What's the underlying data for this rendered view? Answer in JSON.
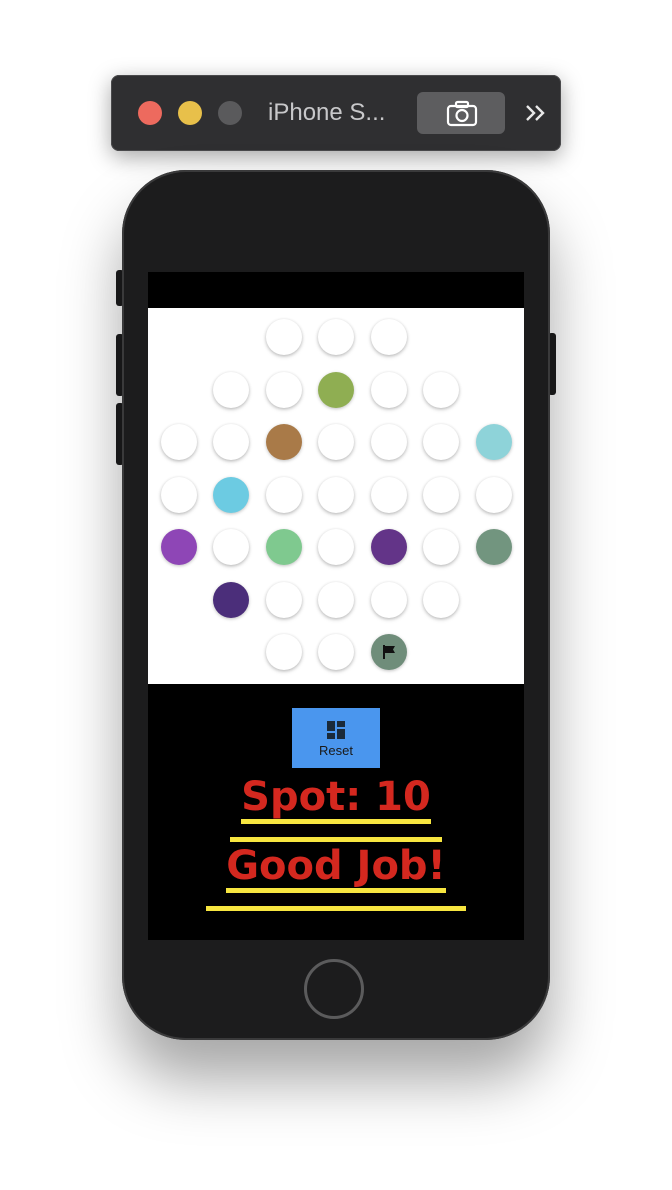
{
  "window": {
    "title": "iPhone S..."
  },
  "game": {
    "colors": {
      "empty": "#ffffff",
      "green_olive": "#8fae52",
      "brown": "#a97a48",
      "light_teal": "#8ed3d9",
      "sky_blue": "#6ccbe2",
      "violet": "#8e46b6",
      "mint": "#7fc98f",
      "dark_purple": "#633488",
      "sage": "#72957f",
      "indigo": "#4b2e7a",
      "flag_cell": "#6f8d7a"
    },
    "rows": [
      [
        "empty",
        "empty",
        "empty"
      ],
      [
        "empty",
        "empty",
        "green_olive",
        "empty",
        "empty"
      ],
      [
        "empty",
        "empty",
        "brown",
        "empty",
        "empty",
        "empty",
        "light_teal"
      ],
      [
        "empty",
        "sky_blue",
        "empty",
        "empty",
        "empty",
        "empty",
        "empty"
      ],
      [
        "violet",
        "empty",
        "mint",
        "empty",
        "dark_purple",
        "empty",
        "sage"
      ],
      [
        "indigo",
        "empty",
        "empty",
        "empty",
        "empty"
      ],
      [
        "empty",
        "empty",
        "flag_cell"
      ]
    ],
    "flag_icon": "flag-icon"
  },
  "controls": {
    "reset_label": "Reset",
    "reset_icon": "dashboard-icon",
    "button_color": "#4a96ee"
  },
  "status": {
    "spot_text": "Spot: 10",
    "message_text": "Good Job!",
    "text_color": "#d4281f",
    "underline_color": "#f7e640"
  }
}
